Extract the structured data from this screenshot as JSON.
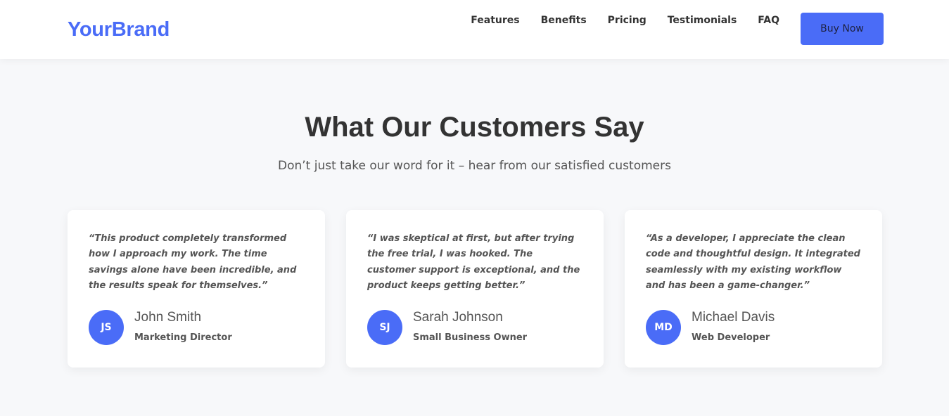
{
  "header": {
    "brand": "YourBrand",
    "nav": [
      {
        "label": "Features"
      },
      {
        "label": "Benefits"
      },
      {
        "label": "Pricing"
      },
      {
        "label": "Testimonials"
      },
      {
        "label": "FAQ"
      }
    ],
    "cta_label": "Buy Now"
  },
  "testimonials": {
    "title": "What Our Customers Say",
    "subtitle": "Don’t just take our word for it – hear from our satisfied customers",
    "items": [
      {
        "quote": "“This product completely transformed how I approach my work. The time savings alone have been incredible, and the results speak for themselves.”",
        "initials": "JS",
        "name": "John Smith",
        "role": "Marketing Director"
      },
      {
        "quote": "“I was skeptical at first, but after trying the free trial, I was hooked. The customer support is exceptional, and the product keeps getting better.”",
        "initials": "SJ",
        "name": "Sarah Johnson",
        "role": "Small Business Owner"
      },
      {
        "quote": "“As a developer, I appreciate the clean code and thoughtful design. It integrated seamlessly with my existing workflow and has been a game-changer.”",
        "initials": "MD",
        "name": "Michael Davis",
        "role": "Web Developer"
      }
    ]
  },
  "colors": {
    "accent": "#4a6cf7",
    "background": "#f7f8fa",
    "card": "#ffffff"
  }
}
